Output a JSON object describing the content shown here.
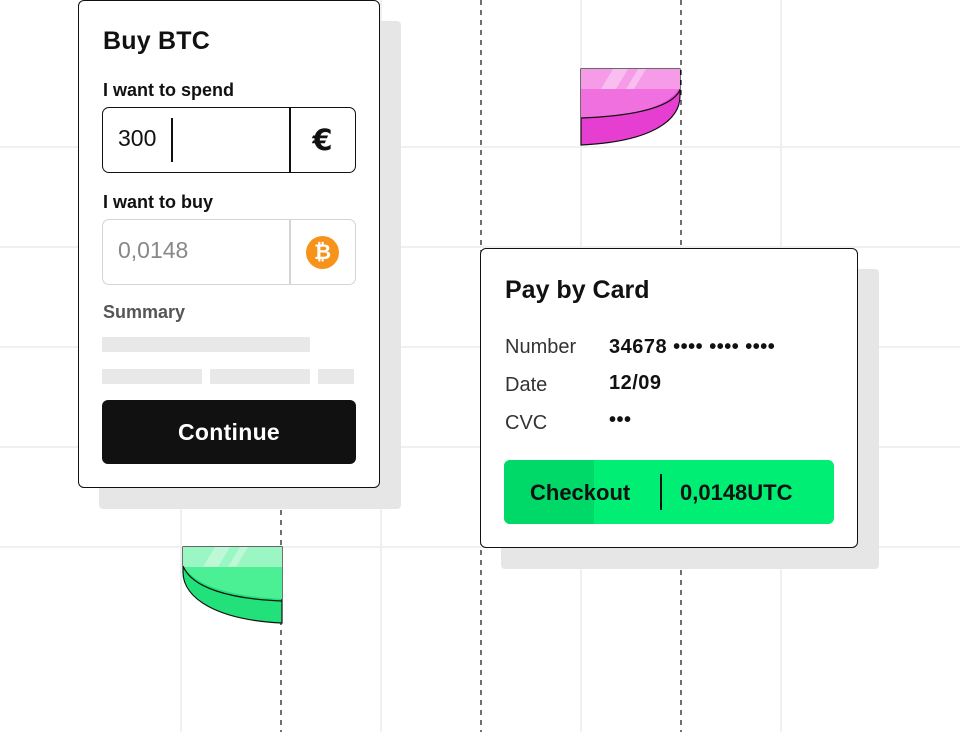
{
  "buy_card": {
    "title": "Buy BTC",
    "spend_label": "I want to spend",
    "spend_value": "300",
    "spend_currency": "€",
    "buy_label": "I want to buy",
    "buy_value": "0,0148",
    "buy_currency_icon": "bitcoin-icon",
    "buy_currency_glyph": "₿",
    "summary_label": "Summary",
    "continue_label": "Continue"
  },
  "pay_card": {
    "title": "Pay by Card",
    "rows": [
      {
        "label": "Number",
        "value": "34678 •••• •••• ••••"
      },
      {
        "label": "Date",
        "value": "12/09"
      },
      {
        "label": "CVC",
        "value": "•••"
      }
    ],
    "checkout_label": "Checkout",
    "checkout_amount": "0,0148UTC"
  },
  "colors": {
    "accent_green": "#00ee73",
    "accent_pink": "#e63ed0",
    "bitcoin_orange": "#f7931a",
    "dark": "#111111"
  }
}
